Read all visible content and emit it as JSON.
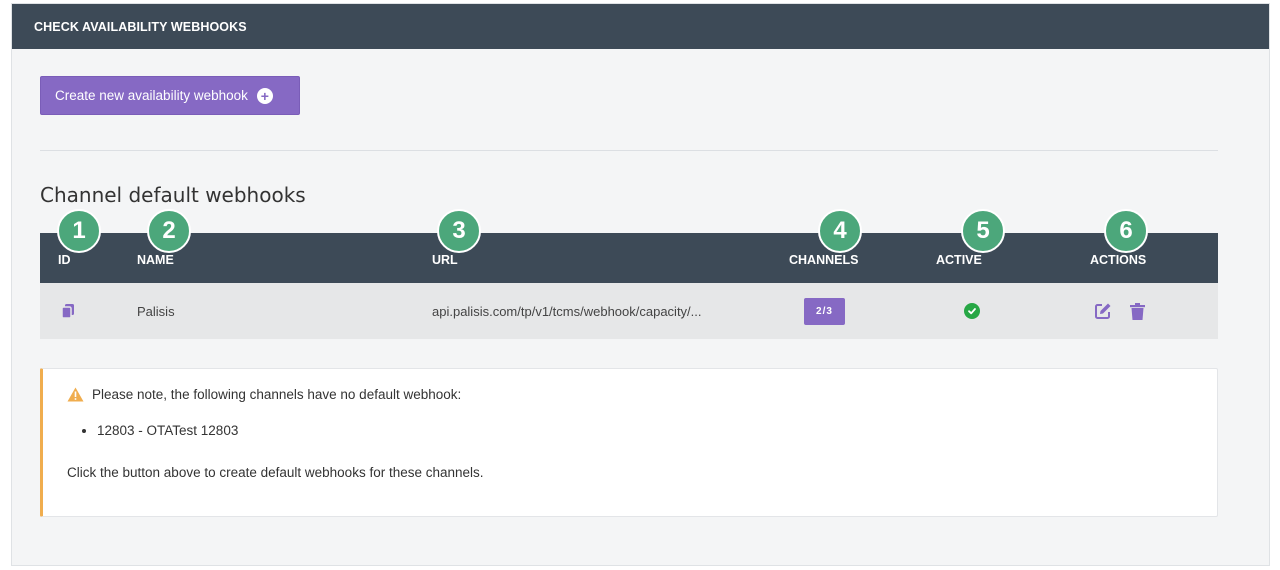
{
  "panel": {
    "title": "CHECK AVAILABILITY WEBHOOKS"
  },
  "create_button": {
    "label": "Create new availability webhook",
    "icon": "plus-circle-icon"
  },
  "section": {
    "title": "Channel default webhooks"
  },
  "callouts": [
    "1",
    "2",
    "3",
    "4",
    "5",
    "6"
  ],
  "table": {
    "columns": [
      "ID",
      "NAME",
      "URL",
      "CHANNELS",
      "ACTIVE",
      "ACTIONS"
    ],
    "rows": [
      {
        "id_icon": "copy-icon",
        "name": "Palisis",
        "url": "api.palisis.com/tp/v1/tcms/webhook/capacity/...",
        "channels": "2/3",
        "active": true,
        "actions": [
          "edit-icon",
          "trash-icon"
        ]
      }
    ]
  },
  "notice": {
    "icon": "warning-icon",
    "message": "Please note, the following channels have no default webhook:",
    "channels": [
      "12803 - OTATest 12803"
    ],
    "footer": "Click the button above to create default webhooks for these channels."
  },
  "colors": {
    "header_bg": "#3d4a57",
    "accent_purple": "#8669c4",
    "callout_green": "#4ca77b",
    "active_green": "#27a745",
    "warning_orange": "#f0ad4e"
  }
}
